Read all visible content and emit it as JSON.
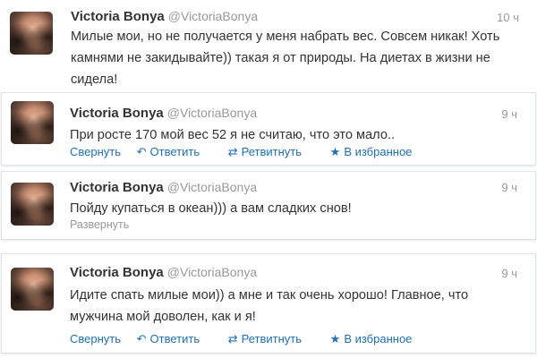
{
  "user": {
    "name": "Victoria Bonya",
    "handle": "@VictoriaBonya"
  },
  "tweets": [
    {
      "time": "10 ч",
      "text": "Милые мои, но не получается у меня набрать вес. Совсем никак! Хоть камнями не закидывайте)) такая я от природы. На диетах в жизни не сидела!"
    },
    {
      "time": "9 ч",
      "text": "При росте 170 мой вес 52 я не считаю, что это мало..",
      "actions": {
        "collapse": "Свернуть",
        "reply": "Ответить",
        "retweet": "Ретвитнуть",
        "favorite": "В избранное"
      }
    },
    {
      "time": "9 ч",
      "text": "Пойду купаться в океан))) а вам сладких снов!",
      "expand": "Развернуть"
    },
    {
      "time": "9 ч",
      "text": "Идите спать милые мои)) а мне и так очень хорошо! Главное, что мужчина мой доволен, как и я!",
      "actions": {
        "collapse": "Свернуть",
        "reply": "Ответить",
        "retweet": "Ретвитнуть",
        "favorite": "В избранное"
      }
    }
  ],
  "icons": {
    "reply": "reply-arrow-icon",
    "retweet": "retweet-icon",
    "favorite": "star-icon"
  },
  "colors": {
    "link": "#1e6fb4",
    "muted": "#999999",
    "text": "#333333"
  }
}
